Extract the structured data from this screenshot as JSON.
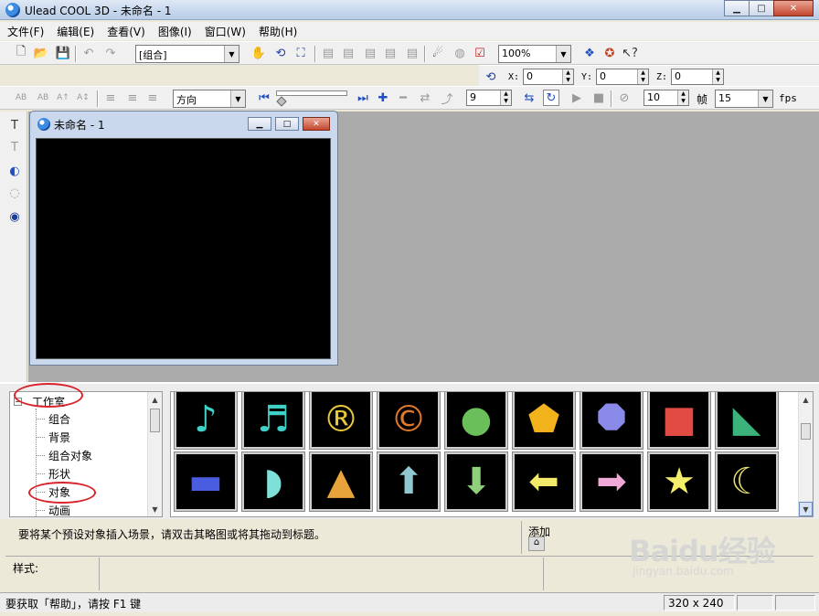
{
  "window": {
    "title": "Ulead COOL 3D - 未命名 - 1",
    "min": "▁",
    "max": "□",
    "close": "✕"
  },
  "menu": [
    "文件(F)",
    "编辑(E)",
    "查看(V)",
    "图像(I)",
    "窗口(W)",
    "帮助(H)"
  ],
  "toolbar1": {
    "object_combo": "[组合]",
    "zoom_combo": "100%"
  },
  "toolbar2": {
    "x_label": "X:",
    "x_value": "0",
    "y_label": "Y:",
    "y_value": "0",
    "z_label": "Z:",
    "z_value": "0"
  },
  "toolbar3": {
    "text_buttons": [
      "AB",
      "AB",
      "A↑",
      "A↕"
    ],
    "direction_combo": "方向",
    "frame_value": "9",
    "frame_count": "10",
    "frame_label": "帧",
    "fps_value": "15",
    "fps_label": "fps"
  },
  "document": {
    "title": "未命名 - 1"
  },
  "tree": {
    "root": "工作室",
    "expander": "−",
    "items": [
      "组合",
      "背景",
      "组合对象",
      "形状",
      "对象",
      "动画"
    ]
  },
  "gallery": {
    "thumbnails": [
      {
        "icon": "music-note-icon",
        "glyph": "♪",
        "color": "#3fd0c8"
      },
      {
        "icon": "double-note-icon",
        "glyph": "♬",
        "color": "#3fd0c8"
      },
      {
        "icon": "registered-icon",
        "glyph": "®",
        "color": "#e8c93a"
      },
      {
        "icon": "copyright-icon",
        "glyph": "©",
        "color": "#e07a2a"
      },
      {
        "icon": "circle-icon",
        "glyph": "●",
        "color": "#6abf5a"
      },
      {
        "icon": "pentagon-icon",
        "glyph": "⬟",
        "color": "#f2b21c"
      },
      {
        "icon": "octagon-icon",
        "glyph": "⯃",
        "color": "#8a8ae8"
      },
      {
        "icon": "square-icon",
        "glyph": "■",
        "color": "#e24a44"
      },
      {
        "icon": "triangle-right-icon",
        "glyph": "◣",
        "color": "#3bb37a"
      },
      {
        "icon": "rounded-rect-icon",
        "glyph": "▬",
        "color": "#4a5ce0"
      },
      {
        "icon": "half-circle-icon",
        "glyph": "◗",
        "color": "#7fe0d8"
      },
      {
        "icon": "triangle-icon",
        "glyph": "▲",
        "color": "#e8a43a"
      },
      {
        "icon": "arrow-up-icon",
        "glyph": "⬆",
        "color": "#8fc8d0"
      },
      {
        "icon": "arrow-down-icon",
        "glyph": "⬇",
        "color": "#8fd07a"
      },
      {
        "icon": "arrow-left-icon",
        "glyph": "⬅",
        "color": "#f2e86a"
      },
      {
        "icon": "arrow-right-icon",
        "glyph": "➡",
        "color": "#f0a8d8"
      },
      {
        "icon": "star-icon",
        "glyph": "★",
        "color": "#f5ee6a"
      },
      {
        "icon": "crescent-icon",
        "glyph": "☾",
        "color": "#e8e070"
      }
    ]
  },
  "panel": {
    "hint": "要将某个预设对象插入场景，请双击其略图或将其拖动到标题。",
    "add_label": "添加",
    "style_label": "样式:"
  },
  "status": {
    "text": "要获取「帮助」，请按 F1 键",
    "size": "320 x 240"
  },
  "watermark": {
    "main": "Baidu经验",
    "sub": "jingyan.baidu.com"
  },
  "colors": {
    "annotation": "#d8232a",
    "workspace": "#ababab"
  }
}
